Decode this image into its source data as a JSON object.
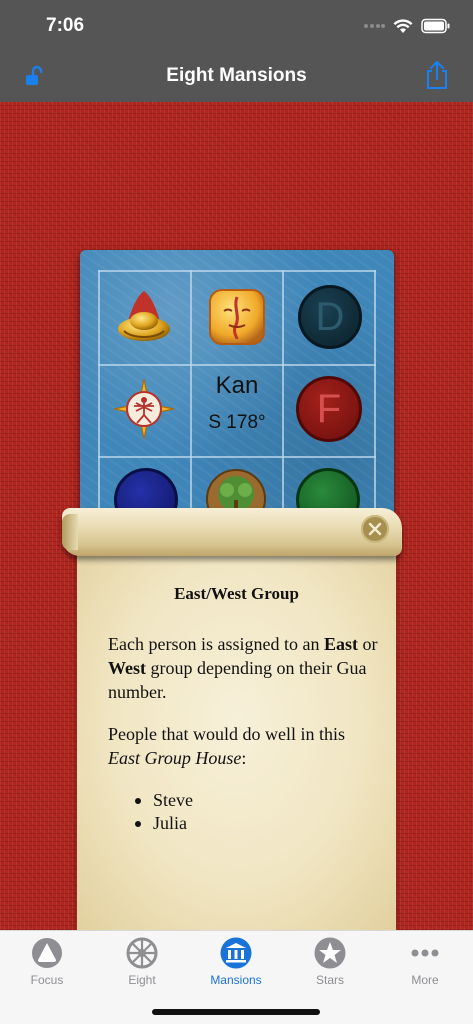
{
  "status": {
    "time": "7:06"
  },
  "nav": {
    "title": "Eight Mansions",
    "left_icon": "unlock-icon",
    "right_icon": "share-icon",
    "accent": "#1a80f0"
  },
  "card": {
    "center_name": "Kan",
    "center_degree": "S 178°",
    "letters": {
      "top_right": "D",
      "middle_right": "F"
    }
  },
  "scroll": {
    "heading": "East/West Group",
    "para1_a": "Each person is assigned to an ",
    "para1_east": "East",
    "para1_or": " or ",
    "para1_west": "West",
    "para1_b": " group depending on their Gua number.",
    "para2_a": "People that would do well in this ",
    "para2_house": "East Group House",
    "para2_b": ":",
    "people": [
      "Steve",
      "Julia"
    ]
  },
  "tabs": [
    {
      "label": "Focus",
      "icon": "triangle-circle-icon"
    },
    {
      "label": "Eight",
      "icon": "wheel-icon"
    },
    {
      "label": "Mansions",
      "icon": "bank-icon",
      "active": true
    },
    {
      "label": "Stars",
      "icon": "star-circle-icon"
    },
    {
      "label": "More",
      "icon": "more-dots-icon"
    }
  ],
  "colors": {
    "active_tab": "#1a73d9",
    "inactive_tab": "#8e8e93",
    "fabric": "#b3261f",
    "card": "#3f86b9"
  }
}
